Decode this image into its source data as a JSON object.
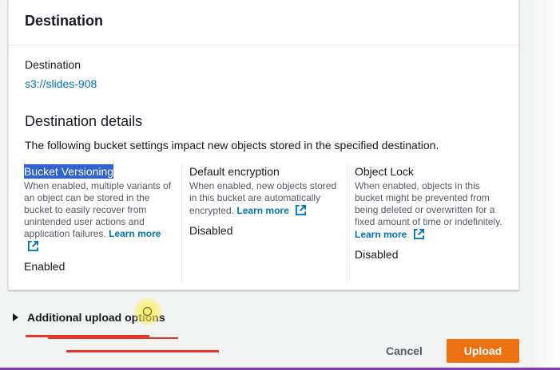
{
  "panel": {
    "title": "Destination",
    "destination_label": "Destination",
    "destination_value": "s3://slides-908",
    "details_title": "Destination details",
    "details_description": "The following bucket settings impact new objects stored in the specified destination."
  },
  "settings": [
    {
      "title": "Bucket Versioning",
      "description": "When enabled, multiple variants of an object can be stored in the bucket to easily recover from unintended user actions and application failures.",
      "learn_more": "Learn more",
      "status": "Enabled",
      "selected": true
    },
    {
      "title": "Default encryption",
      "description": "When enabled, new objects stored in this bucket are automatically encrypted.",
      "learn_more": "Learn more",
      "status": "Disabled"
    },
    {
      "title": "Object Lock",
      "description": "When enabled, objects in this bucket might be prevented from being deleted or overwritten for a fixed amount of time or indefinitely.",
      "learn_more": "Learn more",
      "status": "Disabled"
    }
  ],
  "additional": {
    "label": "Additional upload options",
    "icon": "caret-right-icon"
  },
  "actions": {
    "cancel_label": "Cancel",
    "upload_label": "Upload"
  },
  "colors": {
    "link": "#0073bb",
    "primary_button": "#ec7211",
    "selection": "#3163cc",
    "annotation": "#e8362d"
  }
}
